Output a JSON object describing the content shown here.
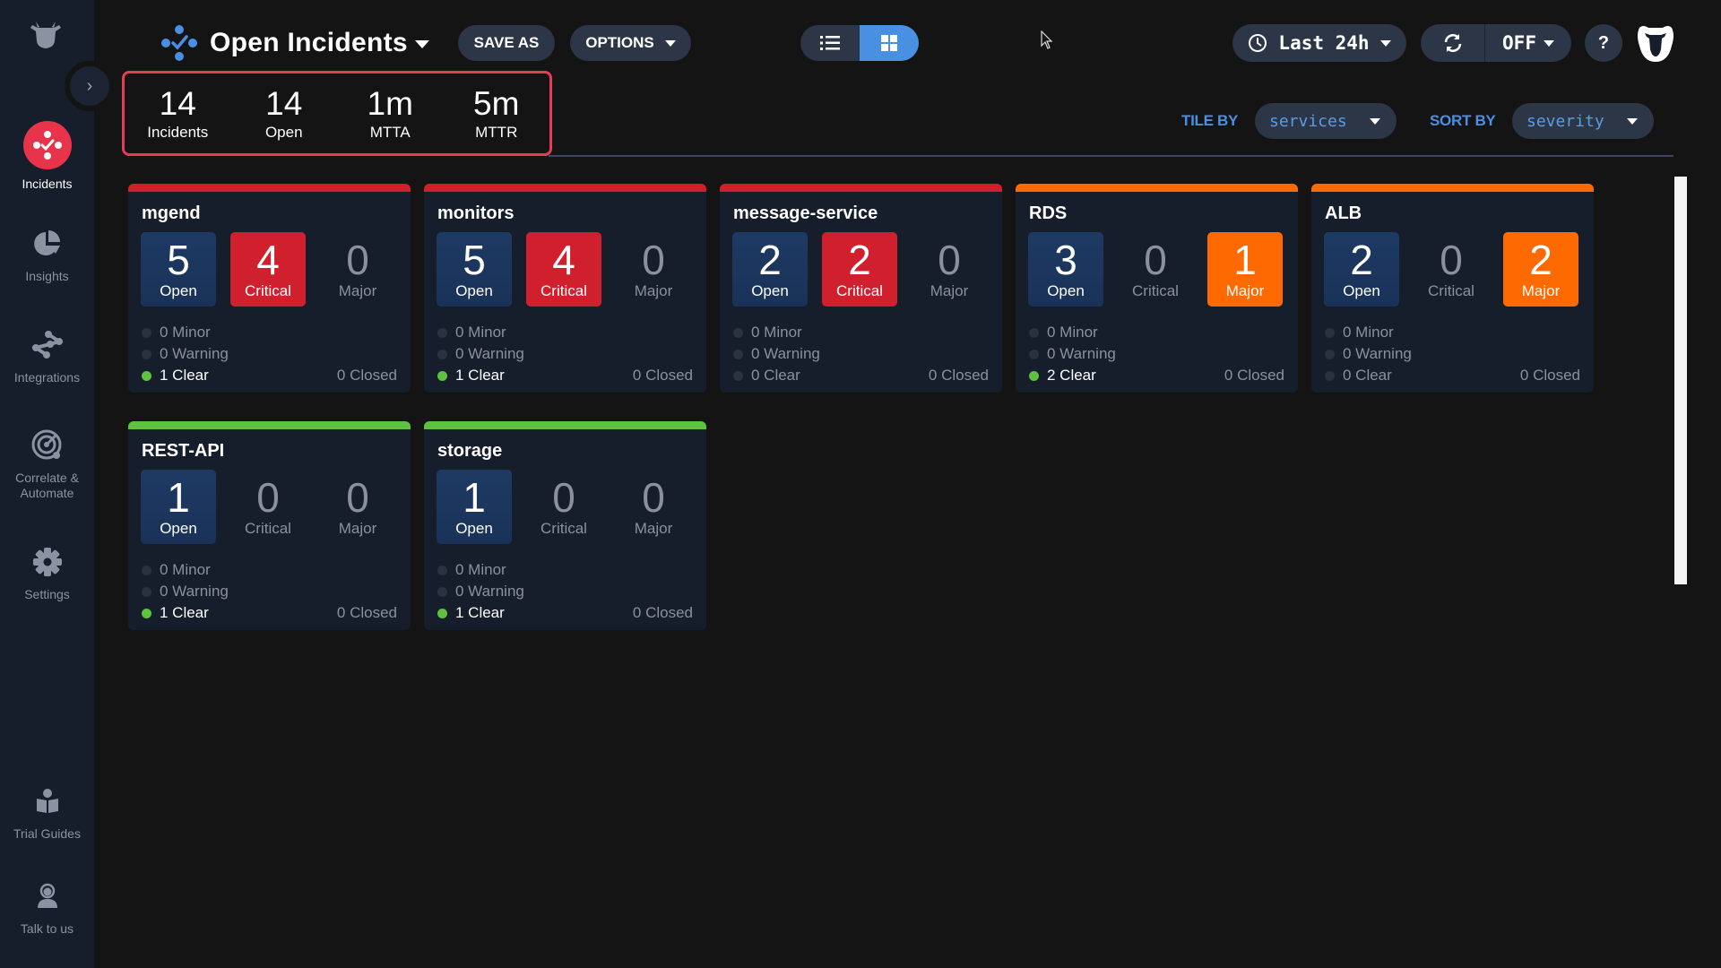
{
  "sidebar": {
    "items": [
      {
        "label": "Incidents",
        "active": true
      },
      {
        "label": "Insights"
      },
      {
        "label": "Integrations"
      },
      {
        "label": "Correlate & Automate"
      },
      {
        "label": "Settings"
      },
      {
        "label": "Trial Guides"
      },
      {
        "label": "Talk to us"
      }
    ]
  },
  "header": {
    "title": "Open Incidents",
    "save_as": "SAVE AS",
    "options": "OPTIONS",
    "time_range": "Last 24h",
    "refresh": "OFF",
    "help": "?"
  },
  "summary": [
    {
      "value": "14",
      "label": "Incidents"
    },
    {
      "value": "14",
      "label": "Open"
    },
    {
      "value": "1m",
      "label": "MTTA"
    },
    {
      "value": "5m",
      "label": "MTTR"
    }
  ],
  "controls": {
    "tile_by_label": "TILE BY",
    "tile_by_value": "services",
    "sort_by_label": "SORT BY",
    "sort_by_value": "severity"
  },
  "colors": {
    "critical": "#d0202e",
    "major": "#ff6a00",
    "clear": "#5ec13f",
    "accent": "#4a90e2",
    "summary_border": "#e23e57"
  },
  "cards": [
    {
      "name": "mgend",
      "status": "critical",
      "open": "5",
      "critical": "4",
      "major": "0",
      "minor": "0 Minor",
      "warning": "0 Warning",
      "clear": "1 Clear",
      "clear_active": true,
      "closed": "0 Closed"
    },
    {
      "name": "monitors",
      "status": "critical",
      "open": "5",
      "critical": "4",
      "major": "0",
      "minor": "0 Minor",
      "warning": "0 Warning",
      "clear": "1 Clear",
      "clear_active": true,
      "closed": "0 Closed"
    },
    {
      "name": "message-service",
      "status": "critical",
      "open": "2",
      "critical": "2",
      "major": "0",
      "minor": "0 Minor",
      "warning": "0 Warning",
      "clear": "0 Clear",
      "clear_active": false,
      "closed": "0 Closed"
    },
    {
      "name": "RDS",
      "status": "major",
      "open": "3",
      "critical": "0",
      "major": "1",
      "minor": "0 Minor",
      "warning": "0 Warning",
      "clear": "2 Clear",
      "clear_active": true,
      "closed": "0 Closed"
    },
    {
      "name": "ALB",
      "status": "major",
      "open": "2",
      "critical": "0",
      "major": "2",
      "minor": "0 Minor",
      "warning": "0 Warning",
      "clear": "0 Clear",
      "clear_active": false,
      "closed": "0 Closed"
    },
    {
      "name": "REST-API",
      "status": "clear",
      "open": "1",
      "critical": "0",
      "major": "0",
      "minor": "0 Minor",
      "warning": "0 Warning",
      "clear": "1 Clear",
      "clear_active": true,
      "closed": "0 Closed"
    },
    {
      "name": "storage",
      "status": "clear",
      "open": "1",
      "critical": "0",
      "major": "0",
      "minor": "0 Minor",
      "warning": "0 Warning",
      "clear": "1 Clear",
      "clear_active": true,
      "closed": "0 Closed"
    }
  ],
  "box_labels": {
    "open": "Open",
    "critical": "Critical",
    "major": "Major"
  }
}
